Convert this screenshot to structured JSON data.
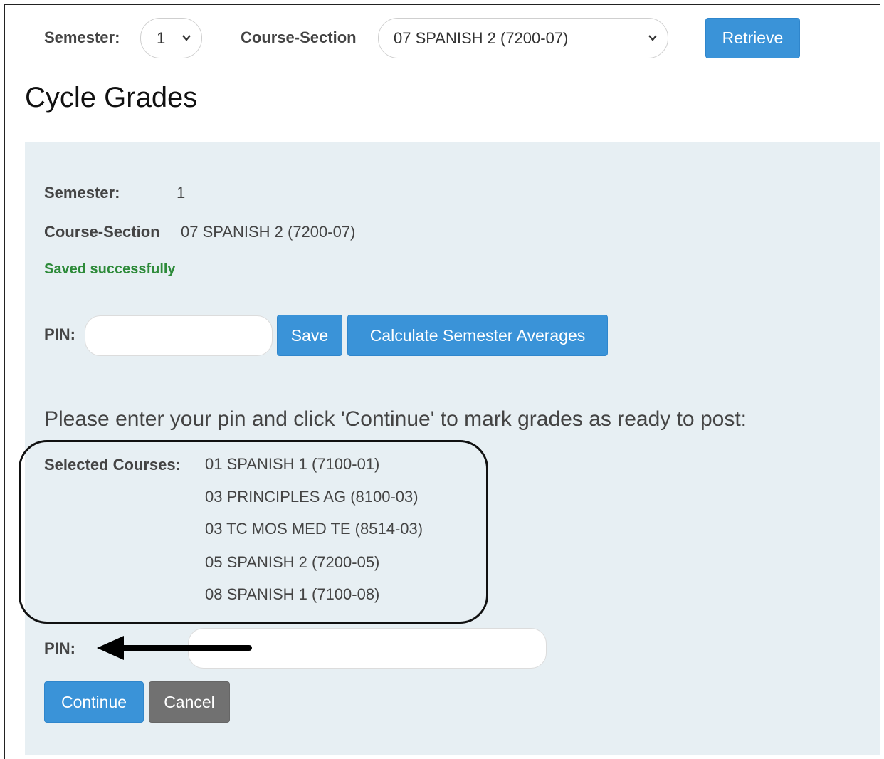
{
  "top_bar": {
    "semester_label": "Semester:",
    "semester_value": "1",
    "course_section_label": "Course-Section",
    "course_section_value": "07 SPANISH 2 (7200-07)",
    "retrieve_label": "Retrieve"
  },
  "page_title": "Cycle Grades",
  "panel": {
    "semester_label": "Semester:",
    "semester_value": "1",
    "course_section_label": "Course-Section",
    "course_section_value": "07 SPANISH 2 (7200-07)",
    "status_message": "Saved successfully",
    "pin_label": "PIN:",
    "pin_value": "",
    "save_label": "Save",
    "calculate_label": "Calculate Semester Averages",
    "prompt_text": "Please enter your pin and click 'Continue' to mark grades as ready to post:",
    "selected_courses_label": "Selected Courses:",
    "selected_courses": [
      "01 SPANISH 1 (7100-01)",
      "03 PRINCIPLES AG (8100-03)",
      "03 TC MOS MED TE (8514-03)",
      "05 SPANISH 2 (7200-05)",
      "08 SPANISH 1 (7100-08)"
    ],
    "confirm_pin_label": "PIN:",
    "confirm_pin_value": "",
    "continue_label": "Continue",
    "cancel_label": "Cancel"
  },
  "icons": {
    "dropdown": "chevron-down-icon",
    "annotation": "arrow-left-icon"
  },
  "colors": {
    "primary_button": "#3a93d8",
    "secondary_button": "#717171",
    "panel_background": "#e7eff3",
    "success_text": "#2e8b3a"
  }
}
